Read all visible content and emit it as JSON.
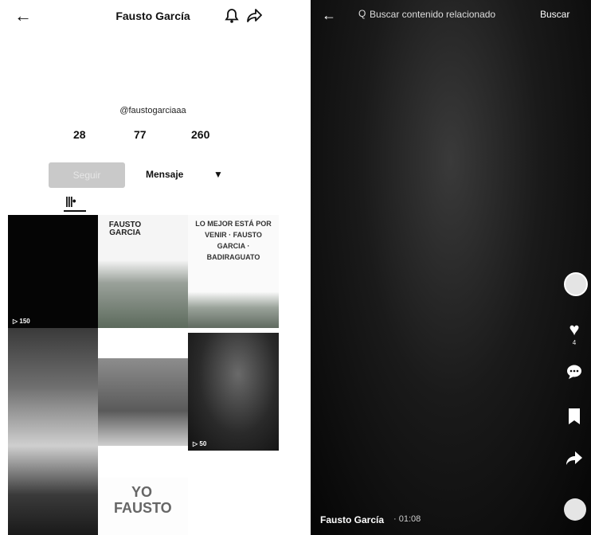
{
  "profile": {
    "name": "Fausto García",
    "handle": "@faustogarciaaa",
    "stats": [
      "28",
      "77",
      "260"
    ],
    "follow_label": "Seguir",
    "message_label": "Mensaje",
    "grid_tab_label": "|||•"
  },
  "icons": {
    "back": "←",
    "bell": "🔔",
    "share": "➦",
    "dropdown": "▼",
    "search": "Q",
    "heart": "♥",
    "comment": "💬",
    "bookmark": "🔖",
    "share_side": "➦"
  },
  "tiles": [
    {
      "plays": "▷ 150",
      "caption": ""
    },
    {
      "plays": "",
      "caption": "FAUSTO GARCIA"
    },
    {
      "plays": "",
      "caption": "LO MEJOR ESTÁ POR VENIR · FAUSTO GARCIA · BADIRAGUATO"
    },
    {
      "plays": "",
      "caption": ""
    },
    {
      "plays": "",
      "caption": ""
    },
    {
      "plays": "▷ 50",
      "caption": ""
    },
    {
      "plays": "",
      "caption": ""
    },
    {
      "plays": "",
      "caption": "YO FAUSTO"
    }
  ],
  "video": {
    "search_placeholder": "Buscar contenido relacionado",
    "search_button": "Buscar",
    "author": "Fausto García",
    "time": "· 01:08",
    "likes_count": "4"
  }
}
